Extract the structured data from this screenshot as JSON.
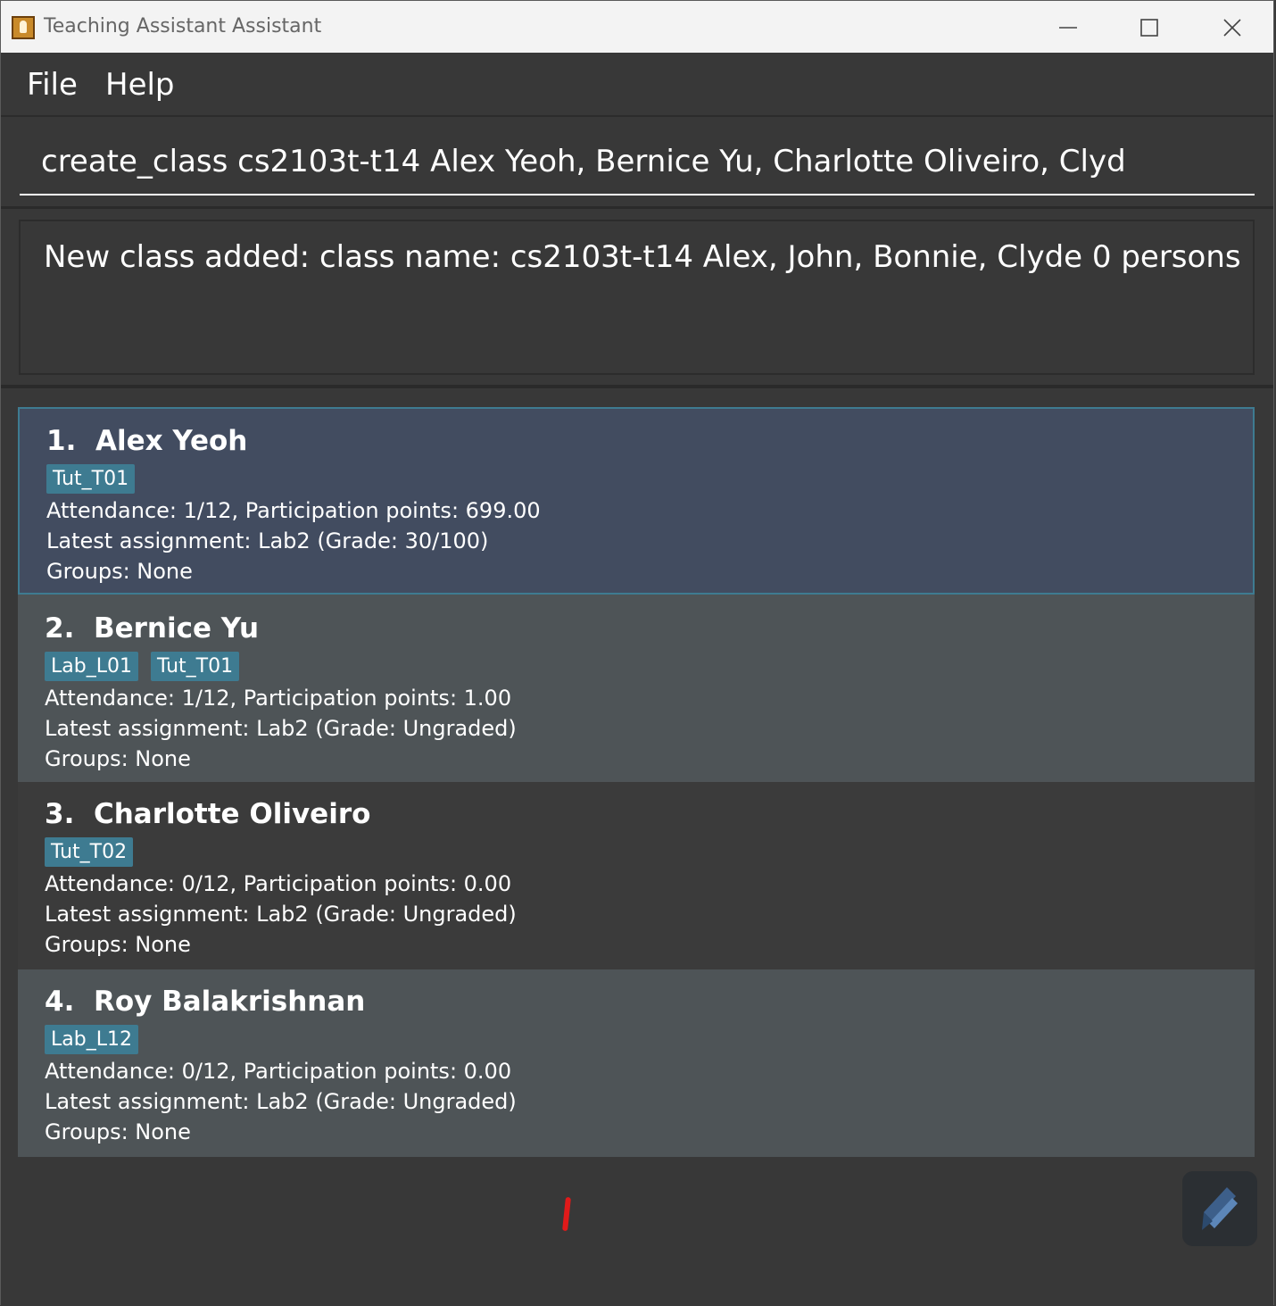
{
  "window": {
    "title": "Teaching Assistant Assistant"
  },
  "menu": {
    "file": "File",
    "help": "Help"
  },
  "command": {
    "value": "create_class cs2103t-t14 Alex Yeoh, Bernice Yu, Charlotte Oliveiro, Clyd"
  },
  "result": {
    "message": "New class added: class name: cs2103t-t14 Alex, John, Bonnie, Clyde 0 persons"
  },
  "persons": [
    {
      "index": "1.",
      "name": "Alex Yeoh",
      "tags": [
        "Tut_T01"
      ],
      "attendance": "Attendance: 1/12, Participation points: 699.00",
      "assignment": "Latest assignment: Lab2 (Grade: 30/100)",
      "groups": "Groups: None"
    },
    {
      "index": "2.",
      "name": "Bernice Yu",
      "tags": [
        "Lab_L01",
        "Tut_T01"
      ],
      "attendance": "Attendance: 1/12, Participation points: 1.00",
      "assignment": "Latest assignment: Lab2 (Grade: Ungraded)",
      "groups": "Groups: None"
    },
    {
      "index": "3.",
      "name": "Charlotte Oliveiro",
      "tags": [
        "Tut_T02"
      ],
      "attendance": "Attendance: 0/12, Participation points: 0.00",
      "assignment": "Latest assignment: Lab2 (Grade: Ungraded)",
      "groups": "Groups: None"
    },
    {
      "index": "4.",
      "name": "Roy Balakrishnan",
      "tags": [
        "Lab_L12"
      ],
      "attendance": "Attendance: 0/12, Participation points: 0.00",
      "assignment": "Latest assignment: Lab2 (Grade: Ungraded)",
      "groups": "Groups: None"
    }
  ],
  "colors": {
    "selected_card": "#424c60",
    "tag": "#3e7b91",
    "accent_border": "#3e7b91"
  },
  "icons": {
    "app": "address-book-icon",
    "minimize": "minimize-icon",
    "maximize": "maximize-icon",
    "close": "close-icon",
    "fab": "edit-pen-icon"
  }
}
